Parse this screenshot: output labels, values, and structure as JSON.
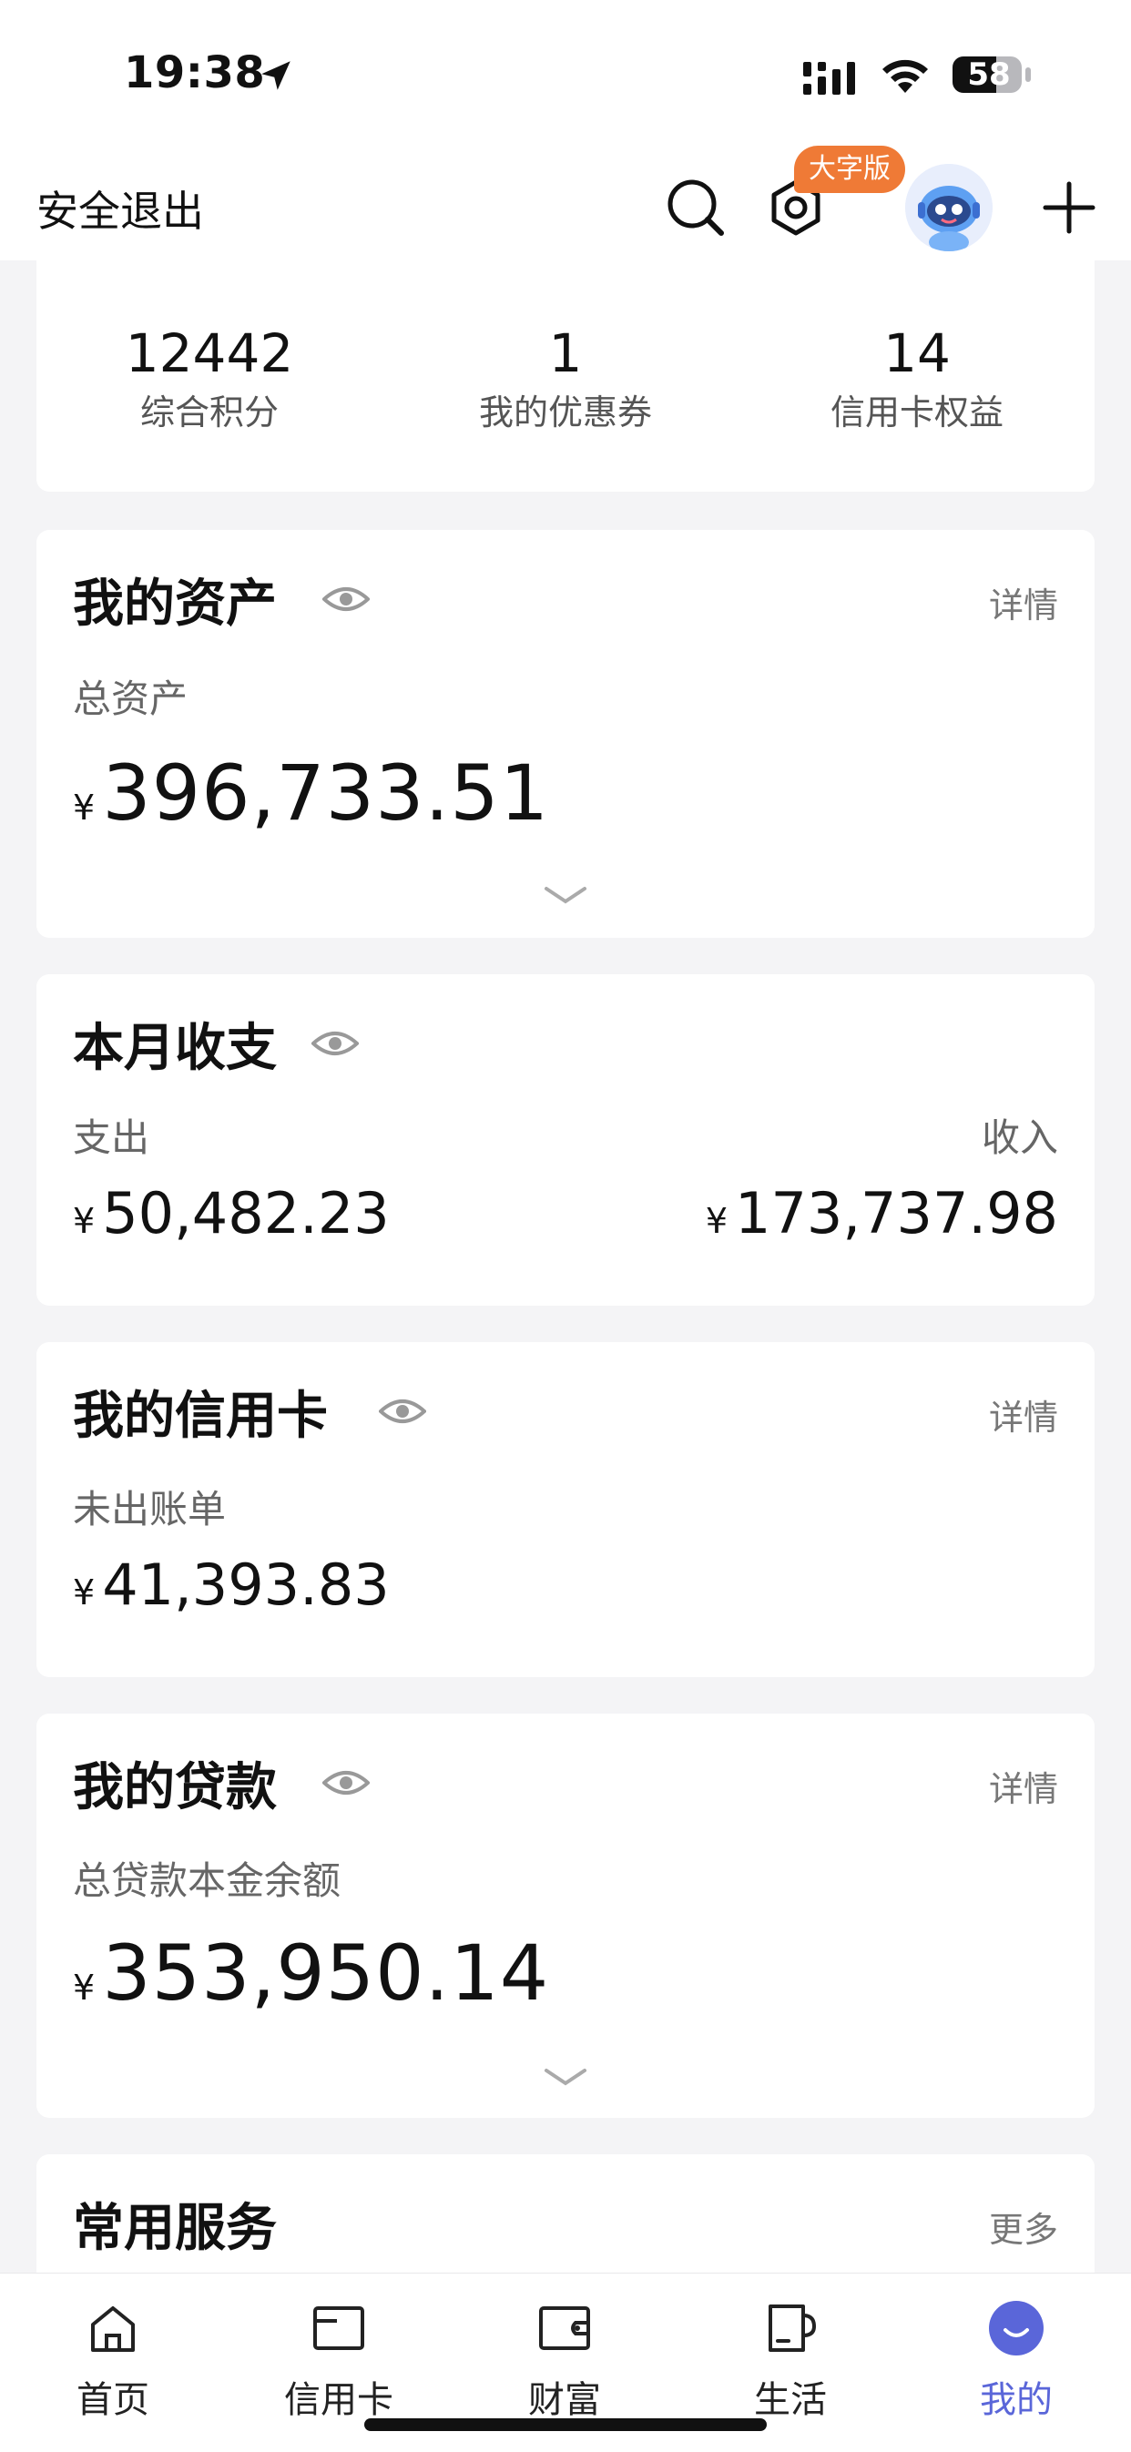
{
  "status_bar": {
    "time": "19:38",
    "battery": "58"
  },
  "header": {
    "logout_label": "安全退出",
    "bigtext_badge": "大字版"
  },
  "stats": [
    {
      "value": "12442",
      "label": "综合积分"
    },
    {
      "value": "1",
      "label": "我的优惠券"
    },
    {
      "value": "14",
      "label": "信用卡权益"
    }
  ],
  "assets": {
    "title": "我的资产",
    "detail": "详情",
    "sub_label": "总资产",
    "currency": "¥",
    "amount": "396,733.51"
  },
  "month": {
    "title": "本月收支",
    "expense_label": "支出",
    "income_label": "收入",
    "currency": "¥",
    "expense": "50,482.23",
    "income": "173,737.98"
  },
  "credit": {
    "title": "我的信用卡",
    "detail": "详情",
    "sub_label": "未出账单",
    "currency": "¥",
    "amount": "41,393.83"
  },
  "loan": {
    "title": "我的贷款",
    "detail": "详情",
    "sub_label": "总贷款本金余额",
    "currency": "¥",
    "amount": "353,950.14"
  },
  "services": {
    "title": "常用服务",
    "more": "更多"
  },
  "tabs": [
    {
      "label": "首页",
      "icon": "home-icon"
    },
    {
      "label": "信用卡",
      "icon": "credit-card-icon"
    },
    {
      "label": "财富",
      "icon": "wallet-icon"
    },
    {
      "label": "生活",
      "icon": "cup-icon"
    },
    {
      "label": "我的",
      "icon": "profile-icon",
      "active": true
    }
  ],
  "colors": {
    "accent": "#5a66d9",
    "badge": "#ef7a36"
  }
}
